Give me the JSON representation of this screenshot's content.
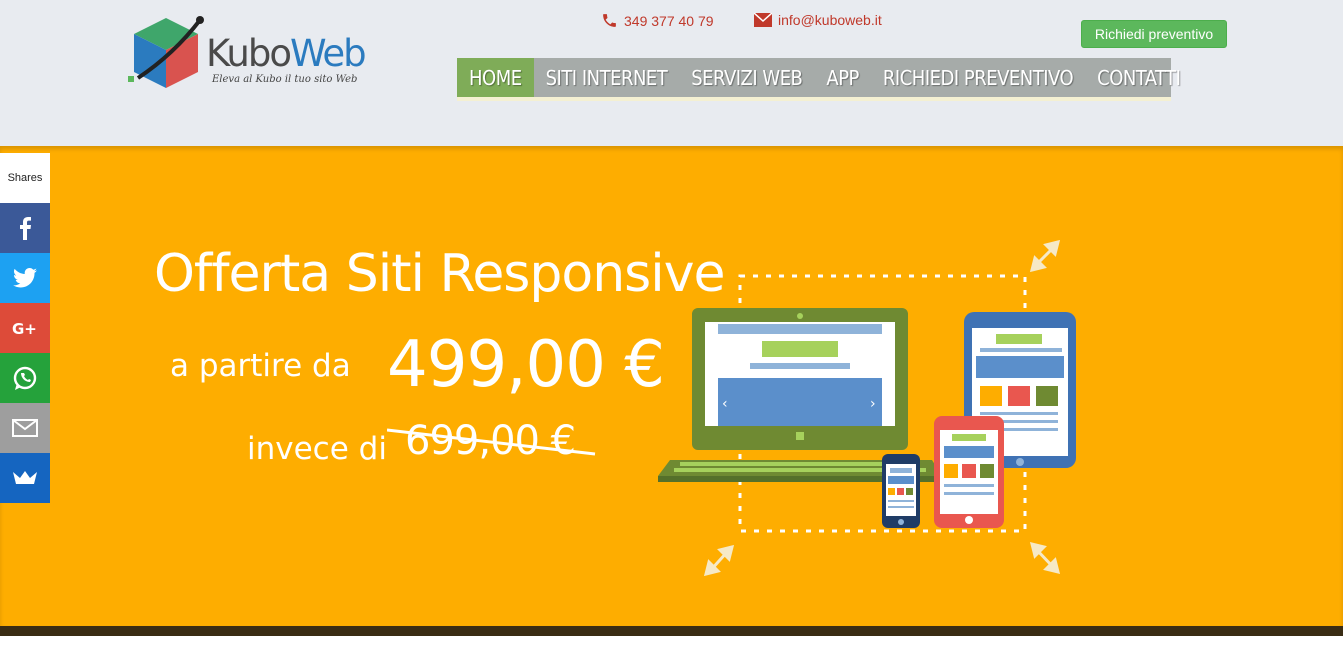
{
  "brand": {
    "name_part1": "Kubo",
    "name_part2": "Web",
    "tagline": "Eleva al Kubo il tuo sito Web"
  },
  "contacts": {
    "phone": "349 377 40 79",
    "email": "info@kuboweb.it"
  },
  "cta": {
    "label": "Richiedi preventivo"
  },
  "nav": {
    "items": [
      {
        "label": "HOME",
        "active": true
      },
      {
        "label": "SITI INTERNET"
      },
      {
        "label": "SERVIZI WEB"
      },
      {
        "label": "APP"
      },
      {
        "label": "RICHIEDI PREVENTIVO"
      },
      {
        "label": "CONTATTI"
      }
    ]
  },
  "hero": {
    "title": "Offerta Siti Responsive",
    "from_label": "a partire da",
    "price": "499,00 €",
    "instead_label": "invece di",
    "old_price": "699,00 €"
  },
  "share": {
    "label": "Shares",
    "buttons": [
      {
        "icon": "facebook-icon",
        "color": "#3b5998"
      },
      {
        "icon": "twitter-icon",
        "color": "#1da1f2"
      },
      {
        "icon": "google-plus-icon",
        "color": "#dd4b39"
      },
      {
        "icon": "whatsapp-icon",
        "color": "#25a23b"
      },
      {
        "icon": "email-icon",
        "color": "#9e9e9e"
      },
      {
        "icon": "crown-icon",
        "color": "#1565c0"
      }
    ]
  },
  "colors": {
    "hero_bg": "#fead00",
    "nav_bg": "#a6aba9",
    "nav_active": "#7fac58",
    "cta_green": "#5cb85c",
    "contact_red": "#c0392b"
  }
}
